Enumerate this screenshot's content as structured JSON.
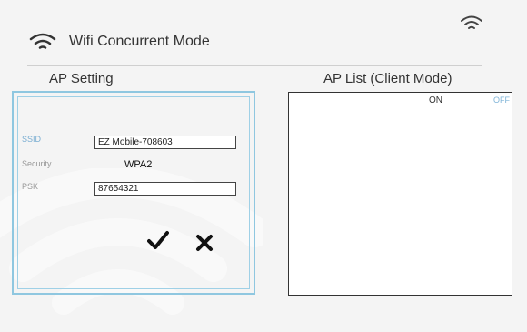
{
  "header": {
    "title": "Wifi Concurrent Mode",
    "icon": "wifi-icon"
  },
  "status_bar": {
    "icon": "wifi-icon"
  },
  "ap_setting": {
    "title": "AP Setting",
    "ssid_label": "SSID",
    "ssid_value": "EZ Mobile-708603",
    "security_label": "Security",
    "security_value": "WPA2",
    "psk_label": "PSK",
    "psk_value": "87654321",
    "confirm_icon": "checkmark-icon",
    "cancel_icon": "close-icon"
  },
  "ap_list": {
    "title": "AP List (Client Mode)",
    "on_label": "ON",
    "off_label": "OFF"
  },
  "colors": {
    "accent": "#7fb4d8",
    "panel_border": "#8fc7e0"
  }
}
